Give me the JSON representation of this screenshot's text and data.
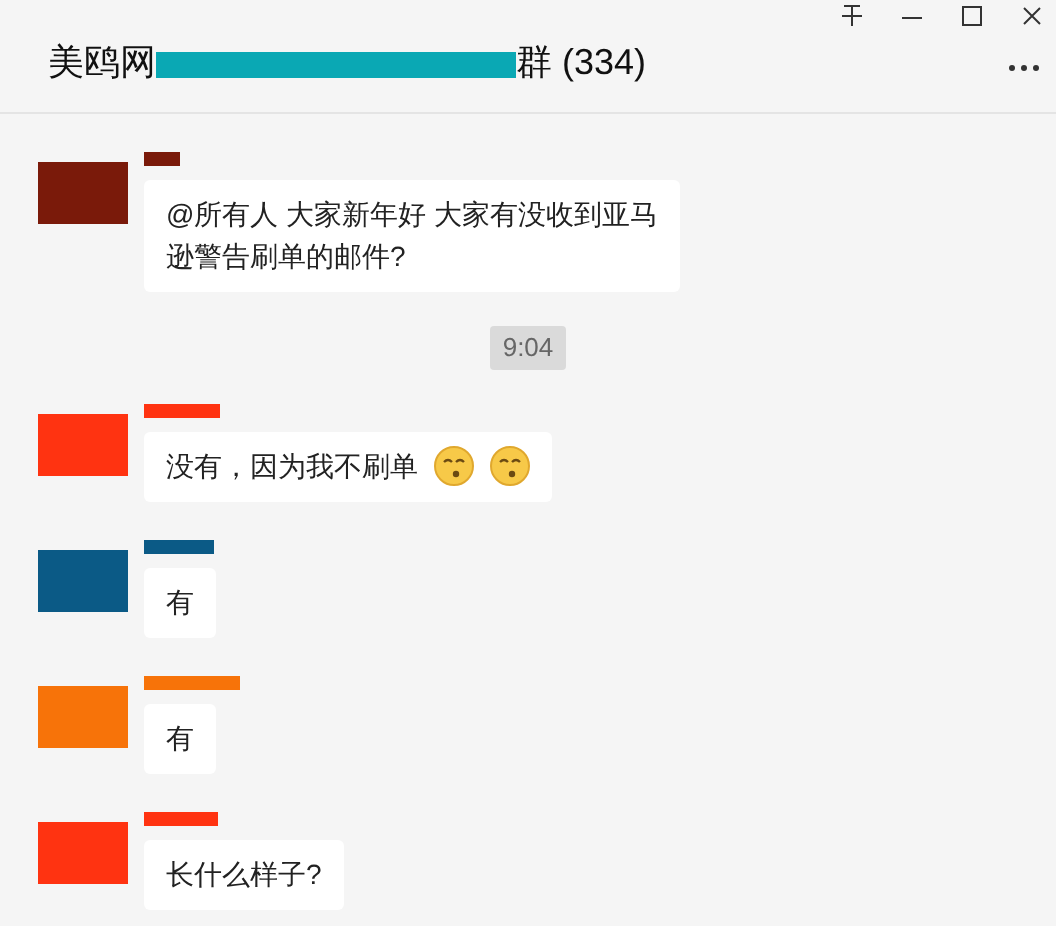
{
  "window": {
    "title_start": "美鸥网",
    "title_end": "群 (334)"
  },
  "messages": [
    {
      "kind": "text",
      "color": "#7a1a0a",
      "lines": [
        "@所有人   大家新年好  大家有没收到亚马",
        "逊警告刷单的邮件?"
      ]
    },
    {
      "kind": "time",
      "text": "9:04"
    },
    {
      "kind": "text",
      "color": "#ff3311",
      "lines": [
        "没有，因为我不刷单"
      ],
      "trailing_emoji": [
        {
          "kind": "face"
        },
        {
          "kind": "face"
        }
      ]
    },
    {
      "kind": "text",
      "color": "#0b5a86",
      "lines": [
        "有"
      ]
    },
    {
      "kind": "text",
      "color": "#f77309",
      "lines": [
        "有"
      ]
    },
    {
      "kind": "text",
      "color": "#ff3311",
      "lines": [
        "长什么样子?"
      ]
    }
  ]
}
